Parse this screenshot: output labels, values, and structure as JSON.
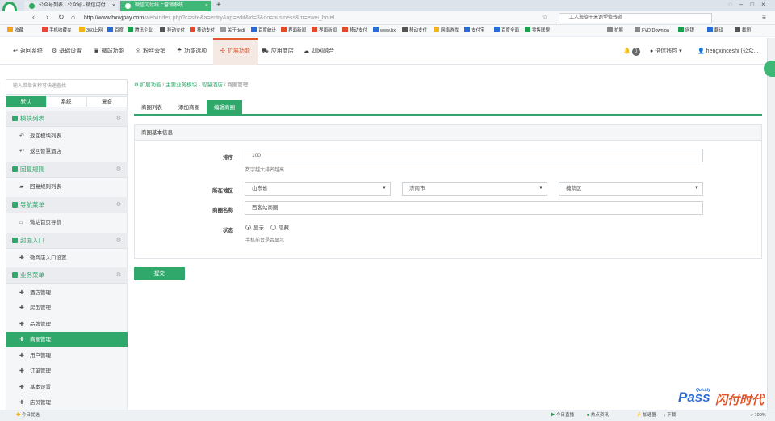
{
  "browser": {
    "tabs": [
      {
        "label": "公众号列表 - 公众号 - 微信闪付..."
      },
      {
        "label": "微信闪付线上营销系统"
      }
    ],
    "url_host": "http://www.hxwjpay.com",
    "url_path": "/web/index.php?c=site&a=entry&op=edit&id=3&do=business&m=ewei_hotel",
    "search_text": "工人海旋干米诡塑修残道",
    "bookmarks": [
      "收藏",
      "手机收藏夹",
      "360上网",
      "百度",
      "腾讯企业",
      "移动支付",
      "移动支付",
      "关于dedi",
      "百度统计",
      "界面新闻",
      "界面新闻",
      "移动支付",
      "www.hx",
      "移动支付",
      "网络游戏",
      "支付宝",
      "百度全面",
      "零售联盟"
    ],
    "bookmarks_right": [
      "扩展",
      "FVD Downloa",
      "网银",
      "翻译",
      "截图"
    ],
    "status_left": "今日优选",
    "status_items": [
      "今日直播",
      "热点资讯",
      "加速器",
      "下载",
      "100%"
    ],
    "brand": {
      "a": "Pass",
      "b": "闪付时代",
      "small": "Quickly"
    }
  },
  "nav": {
    "items": [
      {
        "label": "返回系统",
        "icon": "back-icon"
      },
      {
        "label": "基础设置",
        "icon": "gear-icon"
      },
      {
        "label": "微站功能",
        "icon": "site-icon"
      },
      {
        "label": "粉丝营销",
        "icon": "fans-icon"
      },
      {
        "label": "功能选项",
        "icon": "umbrella-icon"
      },
      {
        "label": "扩展功能",
        "icon": "extend-icon"
      },
      {
        "label": "应用商店",
        "icon": "cart-icon"
      },
      {
        "label": "四网融合",
        "icon": "cloud-icon"
      }
    ],
    "active_index": 5,
    "badge": "0",
    "wallet": "倍信钱包",
    "user": "hengxinceshi (公众..."
  },
  "sidebar": {
    "search_placeholder": "输入菜单名称可快速查找",
    "tabs": [
      "默认",
      "系统",
      "复合"
    ],
    "groups": [
      {
        "title": "模块列表",
        "items": [
          "返回模块列表",
          "返回智慧酒店"
        ]
      },
      {
        "title": "回复规则",
        "items": [
          "回复规则列表"
        ]
      },
      {
        "title": "导航菜单",
        "items": [
          "微站首页导航"
        ]
      },
      {
        "title": "封面入口",
        "items": [
          "微商店入口设置"
        ]
      },
      {
        "title": "业务菜单",
        "items": [
          "酒店管理",
          "房型管理",
          "品牌管理",
          "商圈管理",
          "用户管理",
          "订单管理",
          "基本设置",
          "店员管理"
        ]
      }
    ],
    "active_item": "商圈管理"
  },
  "breadcrumb": {
    "root": "扩展功能",
    "sep": "/",
    "mid": "主要业务模块 - 智慧酒店",
    "current": "商圈管理"
  },
  "page_tabs": [
    "商圈列表",
    "添加商圈",
    "编辑商圈"
  ],
  "form": {
    "panel_title": "商圈基本信息",
    "sort_label": "排序",
    "sort_value": "100",
    "sort_help": "数字越大排名越高",
    "region_label": "所在地区",
    "province": "山东省",
    "city": "济南市",
    "district": "槐荫区",
    "name_label": "商圈名称",
    "name_value": "西客站商圈",
    "status_label": "状态",
    "status_show": "显示",
    "status_hide": "隐藏",
    "status_help": "手机前台是否显示",
    "submit": "提交"
  }
}
